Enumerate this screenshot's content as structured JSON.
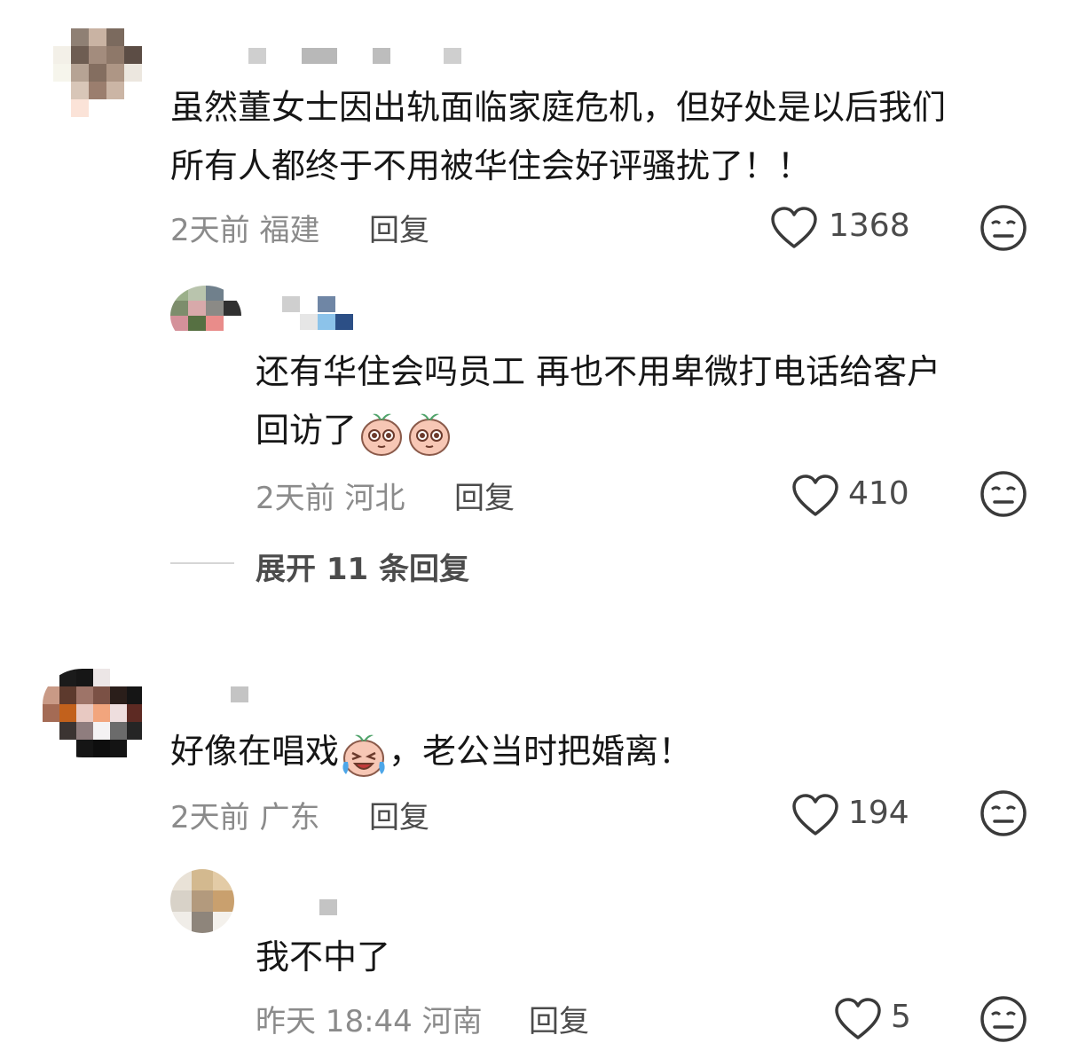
{
  "comments": [
    {
      "text_line1": "虽然董女士因出轨面临家庭危机，但好处是以后我们",
      "text_line2": "所有人都终于不用被华住会好评骚扰了！！",
      "time": "2天前",
      "location": "福建",
      "reply_label": "回复",
      "likes": "1368"
    },
    {
      "text_line1": "还有华住会吗员工 再也不用卑微打电话给客户",
      "text_line2": "回访了",
      "time": "2天前",
      "location": "河北",
      "reply_label": "回复",
      "likes": "410"
    },
    {
      "text_before_emoji": "好像在唱戏",
      "text_after_emoji": "，老公当时把婚离！",
      "time": "2天前",
      "location": "广东",
      "reply_label": "回复",
      "likes": "194"
    },
    {
      "text": "我不中了",
      "time": "昨天 18:44",
      "location": "河南",
      "reply_label": "回复",
      "likes": "5"
    }
  ],
  "expand_replies": "展开 11 条回复",
  "icons": [
    "heart-outline-icon",
    "meh-face-icon",
    "crying-laugh-emoji",
    "teary-eyes-emoji"
  ],
  "colors": {
    "text": "#161616",
    "meta": "#8b8b8b",
    "secondary": "#4b4b4b"
  }
}
